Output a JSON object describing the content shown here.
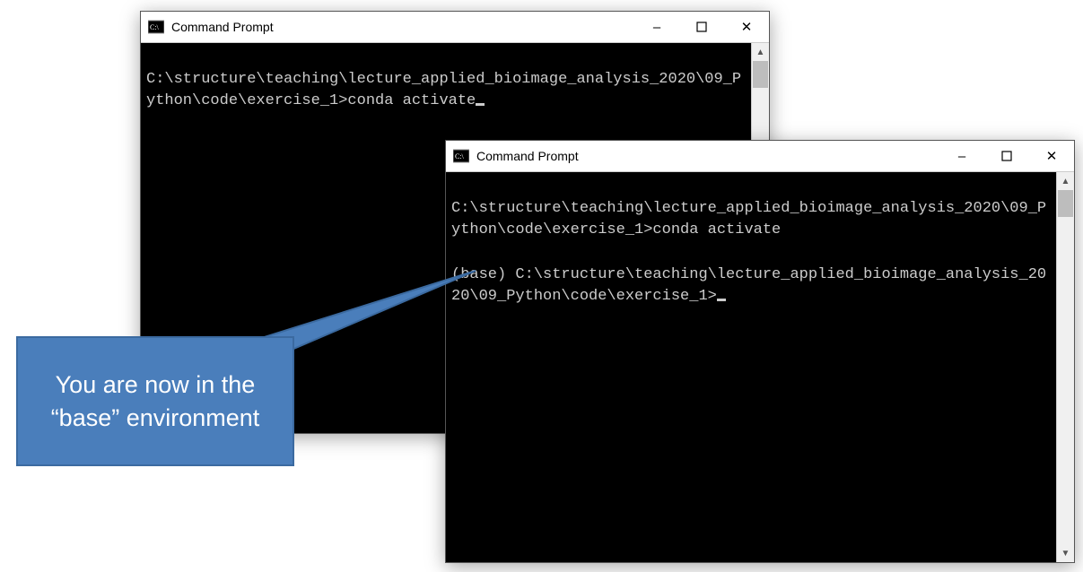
{
  "window1": {
    "title": "Command Prompt",
    "terminal_lines": [
      "",
      "C:\\structure\\teaching\\lecture_applied_bioimage_analysis_2020\\09_Python\\code\\exercise_1>conda activate"
    ]
  },
  "window2": {
    "title": "Command Prompt",
    "terminal_lines": [
      "",
      "C:\\structure\\teaching\\lecture_applied_bioimage_analysis_2020\\09_Python\\code\\exercise_1>conda activate",
      "",
      "(base) C:\\structure\\teaching\\lecture_applied_bioimage_analysis_2020\\09_Python\\code\\exercise_1>"
    ]
  },
  "callout": {
    "text": "You are now in the “base” environment"
  },
  "controls": {
    "minimize": "–",
    "maximize": "☐",
    "close": "✕"
  }
}
